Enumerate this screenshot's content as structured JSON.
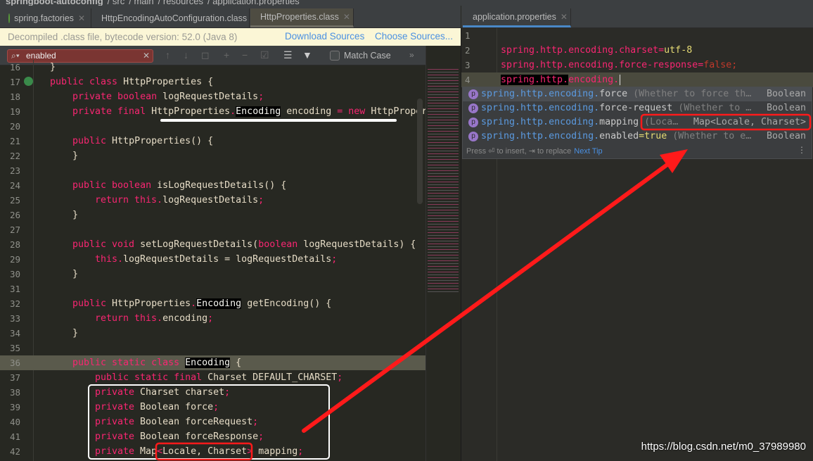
{
  "breadcrumb": [
    "springboot-autoconfig",
    "src",
    "main",
    "resources",
    "application.properties"
  ],
  "left_tabs": [
    {
      "label": "spring.factories",
      "active": false
    },
    {
      "label": "HttpEncodingAutoConfiguration.class",
      "active": false
    },
    {
      "label": "HttpProperties.class",
      "active": true
    }
  ],
  "right_tab": {
    "label": "application.properties"
  },
  "banner": {
    "text": "Decompiled .class file, bytecode version: 52.0 (Java 8)",
    "download": "Download Sources",
    "choose": "Choose Sources..."
  },
  "search": {
    "value": "enabled",
    "match_case": "Match Case",
    "match_case_checked": false
  },
  "code_lines": [
    {
      "n": "16",
      "i": 0,
      "tk": [
        [
          "t",
          "}"
        ]
      ]
    },
    {
      "n": "17",
      "i": 0,
      "tk": [
        [
          "k",
          "public class "
        ],
        [
          "t",
          "HttpProperties {"
        ]
      ]
    },
    {
      "n": "18",
      "i": 1,
      "tk": [
        [
          "k",
          "private boolean "
        ],
        [
          "t",
          "logRequestDetails"
        ],
        [
          "k",
          ";"
        ]
      ]
    },
    {
      "n": "19",
      "i": 1,
      "tk": [
        [
          "k",
          "private final "
        ],
        [
          "t",
          "HttpProperties"
        ],
        [
          "k",
          "."
        ],
        [
          "h",
          "Encoding"
        ],
        [
          "t",
          " encoding "
        ],
        [
          "k",
          "= new "
        ],
        [
          "t",
          "HttpProper"
        ]
      ]
    },
    {
      "n": "20",
      "i": 0,
      "tk": []
    },
    {
      "n": "21",
      "i": 1,
      "tk": [
        [
          "k",
          "public "
        ],
        [
          "t",
          "HttpProperties() {"
        ]
      ]
    },
    {
      "n": "22",
      "i": 1,
      "tk": [
        [
          "t",
          "}"
        ]
      ]
    },
    {
      "n": "23",
      "i": 0,
      "tk": []
    },
    {
      "n": "24",
      "i": 1,
      "tk": [
        [
          "k",
          "public boolean "
        ],
        [
          "t",
          "isLogRequestDetails() {"
        ]
      ]
    },
    {
      "n": "25",
      "i": 2,
      "tk": [
        [
          "k",
          "return this."
        ],
        [
          "t",
          "logRequestDetails"
        ],
        [
          "k",
          ";"
        ]
      ]
    },
    {
      "n": "26",
      "i": 1,
      "tk": [
        [
          "t",
          "}"
        ]
      ]
    },
    {
      "n": "27",
      "i": 0,
      "tk": []
    },
    {
      "n": "28",
      "i": 1,
      "tk": [
        [
          "k",
          "public void "
        ],
        [
          "t",
          "setLogRequestDetails("
        ],
        [
          "k",
          "boolean "
        ],
        [
          "t",
          "logRequestDetails) {"
        ]
      ]
    },
    {
      "n": "29",
      "i": 2,
      "tk": [
        [
          "k",
          "this."
        ],
        [
          "t",
          "logRequestDetails = logRequestDetails"
        ],
        [
          "k",
          ";"
        ]
      ]
    },
    {
      "n": "30",
      "i": 1,
      "tk": [
        [
          "t",
          "}"
        ]
      ]
    },
    {
      "n": "31",
      "i": 0,
      "tk": []
    },
    {
      "n": "32",
      "i": 1,
      "tk": [
        [
          "k",
          "public "
        ],
        [
          "t",
          "HttpProperties"
        ],
        [
          "k",
          "."
        ],
        [
          "h",
          "Encoding"
        ],
        [
          "t",
          " getEncoding() {"
        ]
      ]
    },
    {
      "n": "33",
      "i": 2,
      "tk": [
        [
          "k",
          "return this."
        ],
        [
          "t",
          "encoding"
        ],
        [
          "k",
          ";"
        ]
      ]
    },
    {
      "n": "34",
      "i": 1,
      "tk": [
        [
          "t",
          "}"
        ]
      ]
    },
    {
      "n": "35",
      "i": 0,
      "tk": []
    },
    {
      "n": "36",
      "i": 1,
      "hl": true,
      "tk": [
        [
          "k",
          "public static class "
        ],
        [
          "h",
          "Encoding"
        ],
        [
          "t",
          " {"
        ]
      ]
    },
    {
      "n": "37",
      "i": 2,
      "tk": [
        [
          "k",
          "public static final "
        ],
        [
          "t",
          "Charset DEFAULT_CHARSET"
        ],
        [
          "k",
          ";"
        ]
      ]
    },
    {
      "n": "38",
      "i": 2,
      "tk": [
        [
          "k",
          "private "
        ],
        [
          "t",
          "Charset charset"
        ],
        [
          "k",
          ";"
        ]
      ]
    },
    {
      "n": "39",
      "i": 2,
      "tk": [
        [
          "k",
          "private "
        ],
        [
          "t",
          "Boolean force"
        ],
        [
          "k",
          ";"
        ]
      ]
    },
    {
      "n": "40",
      "i": 2,
      "tk": [
        [
          "k",
          "private "
        ],
        [
          "t",
          "Boolean forceRequest"
        ],
        [
          "k",
          ";"
        ]
      ]
    },
    {
      "n": "41",
      "i": 2,
      "tk": [
        [
          "k",
          "private "
        ],
        [
          "t",
          "Boolean forceResponse"
        ],
        [
          "k",
          ";"
        ]
      ]
    },
    {
      "n": "42",
      "i": 2,
      "tk": [
        [
          "k",
          "private "
        ],
        [
          "t",
          "Map"
        ],
        [
          "k",
          "<"
        ],
        [
          "t",
          "Locale, Charset"
        ],
        [
          "k",
          ">"
        ],
        [
          "t",
          " mapping"
        ],
        [
          "k",
          ";"
        ]
      ]
    }
  ],
  "props_lines": [
    {
      "n": "1",
      "tk": []
    },
    {
      "n": "2",
      "tk": [
        [
          "s",
          "spring.http.encoding.charset="
        ],
        [
          "v",
          "utf-8"
        ]
      ]
    },
    {
      "n": "3",
      "tk": [
        [
          "s",
          "spring.http.encoding.force-response="
        ],
        [
          "f",
          "false;"
        ]
      ]
    },
    {
      "n": "4",
      "cur": true,
      "tk": [
        [
          "sh",
          "spring.http."
        ],
        [
          "s",
          "encoding."
        ]
      ]
    }
  ],
  "completion": {
    "items": [
      {
        "prefix": "spring.http.encoding.",
        "suffix": "force",
        "desc": " (Whether to force th…",
        "type": "Boolean"
      },
      {
        "prefix": "spring.http.encoding.",
        "suffix": "force-request",
        "desc": " (Whether to …",
        "type": "Boolean"
      },
      {
        "prefix": "spring.http.encoding.",
        "suffix": "mapping",
        "desc": " (Loca…",
        "type": "Map<Locale, Charset>"
      },
      {
        "prefix": "spring.http.encoding.",
        "suffix": "enabled",
        "value": "=true",
        "desc": " (Whether to e…",
        "type": "Boolean"
      }
    ],
    "footer": "Press ⏎ to insert, ⇥ to replace",
    "next_tip": "Next Tip"
  },
  "watermark": "https://blog.csdn.net/m0_37989980",
  "colors": {
    "keyword": "#f92672",
    "annotation_red": "#ff1a1a",
    "annotation_white": "#ffffff"
  }
}
